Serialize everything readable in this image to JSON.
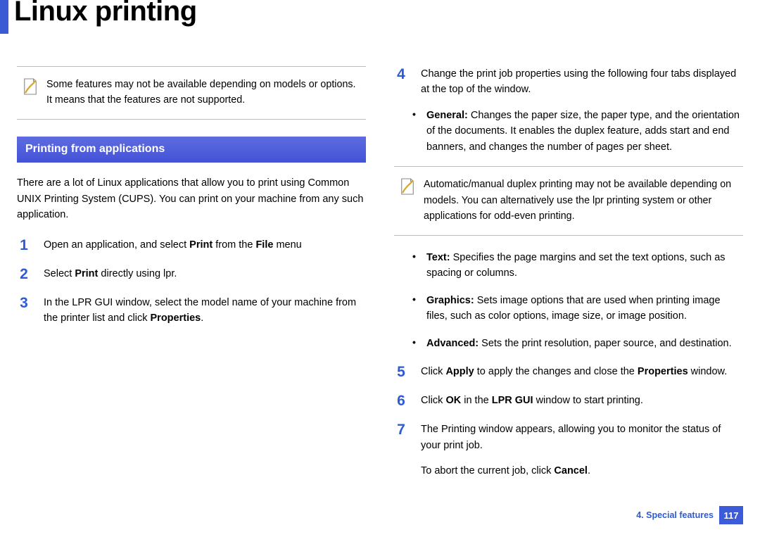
{
  "title": "Linux printing",
  "left": {
    "note": "Some features may not be available depending on models or options. It means that the features are not supported.",
    "section_heading": "Printing from applications",
    "intro": "There are a lot of Linux applications that allow you to print using Common UNIX Printing System (CUPS). You can print on your machine from any such application.",
    "steps": [
      {
        "num": "1",
        "parts": [
          "Open an application, and select ",
          "Print",
          " from the ",
          "File",
          " menu"
        ]
      },
      {
        "num": "2",
        "parts": [
          "Select ",
          "Print",
          " directly using lpr."
        ]
      },
      {
        "num": "3",
        "parts": [
          "In the LPR GUI window, select the model name of your machine from the printer list and click ",
          "Properties",
          "."
        ]
      }
    ]
  },
  "right": {
    "step4": {
      "num": "4",
      "lead": "Change the print job properties using the following four tabs displayed at the top of the window.",
      "bullet1": [
        "General:",
        " Changes the paper size, the paper type, and the orientation of the documents. It enables the duplex feature, adds start and end banners, and changes the number of pages per sheet."
      ]
    },
    "note": "Automatic/manual duplex printing may not be available depending on models. You can alternatively use the lpr printing system or other applications for odd-even printing.",
    "bullets_after": [
      [
        "Text:",
        " Specifies the page margins and set the text options, such as spacing or columns."
      ],
      [
        "Graphics:",
        " Sets image options that are used when printing image files, such as color options, image size, or image position."
      ],
      [
        "Advanced:",
        " Sets the print resolution, paper source, and destination."
      ]
    ],
    "steps": [
      {
        "num": "5",
        "parts": [
          "Click ",
          "Apply",
          " to apply the changes and close the ",
          "Properties",
          " window."
        ]
      },
      {
        "num": "6",
        "parts": [
          "Click ",
          "OK",
          " in the ",
          "LPR GUI",
          " window to start printing."
        ]
      },
      {
        "num": "7",
        "parts": [
          "The Printing window appears, allowing you to monitor the status of your print job."
        ]
      }
    ],
    "tail": [
      "To abort the current job, click ",
      "Cancel",
      "."
    ]
  },
  "footer": {
    "chapter": "4.  Special features",
    "page": "117"
  }
}
